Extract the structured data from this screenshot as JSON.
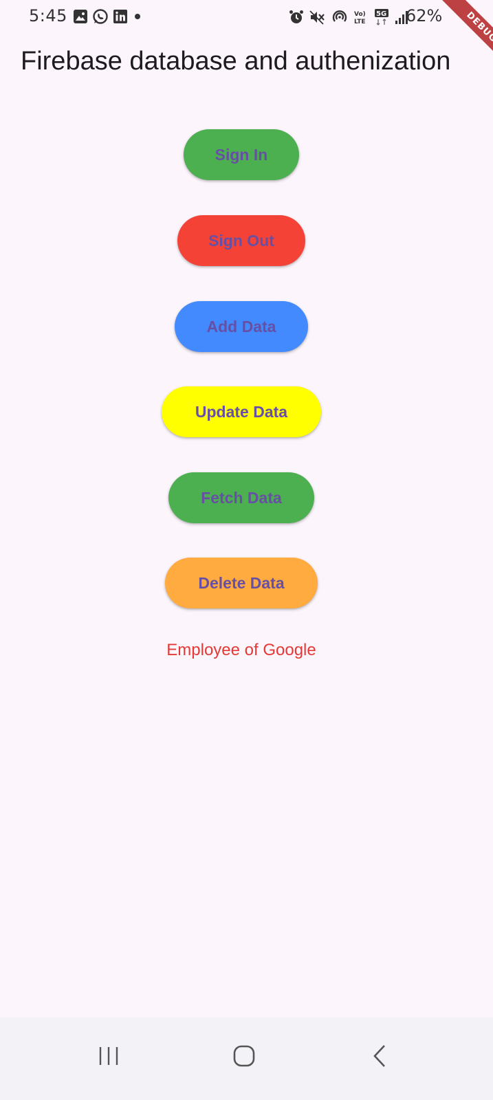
{
  "status_bar": {
    "time": "5:45",
    "battery": "62%",
    "left_icons": [
      "gallery-icon",
      "whatsapp-icon",
      "linkedin-icon",
      "dot-icon"
    ],
    "right_icons": [
      "alarm-icon",
      "mute-icon",
      "hotspot-icon",
      "volte-icon",
      "5g-icon",
      "signal-icon"
    ]
  },
  "debug_banner": "DEBUG",
  "app_bar": {
    "title": "Firebase database and authenization"
  },
  "buttons": {
    "sign_in": {
      "label": "Sign In",
      "color": "#4caf50"
    },
    "sign_out": {
      "label": "Sign Out",
      "color": "#f44336"
    },
    "add_data": {
      "label": "Add Data",
      "color": "#448aff"
    },
    "update_data": {
      "label": "Update Data",
      "color": "#ffff00"
    },
    "fetch_data": {
      "label": "Fetch Data",
      "color": "#4caf50"
    },
    "delete_data": {
      "label": "Delete Data",
      "color": "#ffab40"
    }
  },
  "button_text_color": "#6750a4",
  "employee_text": "Employee of Google",
  "employee_text_color": "#e53935",
  "nav_bar": {
    "icons": [
      "recents-icon",
      "home-icon",
      "back-icon"
    ]
  }
}
